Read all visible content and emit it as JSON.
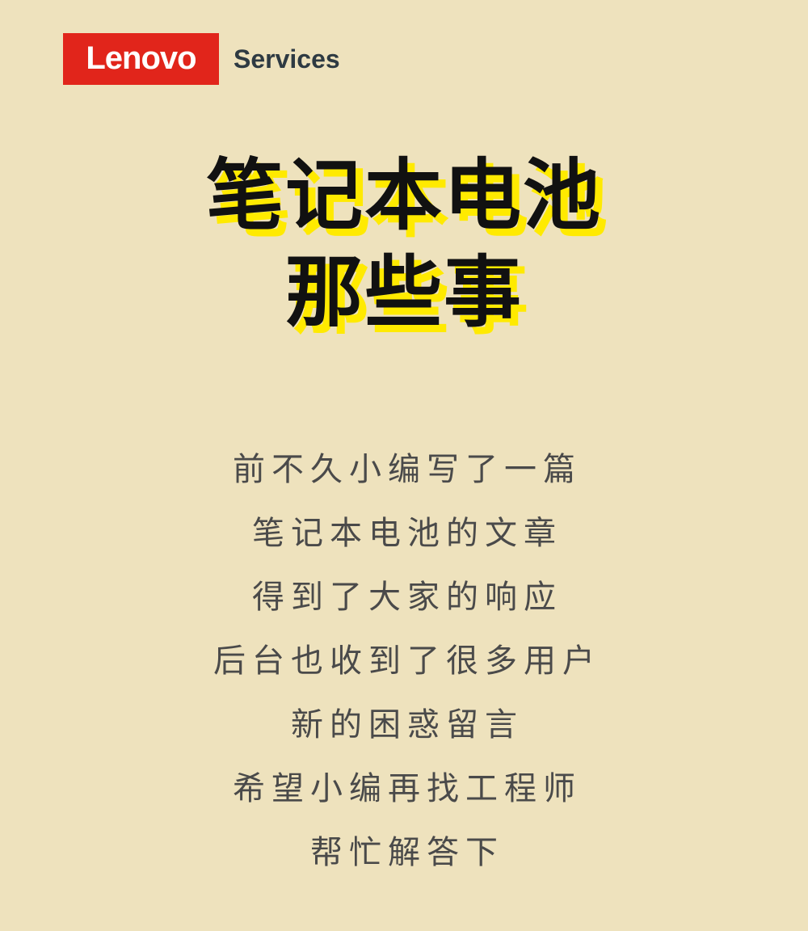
{
  "brand": {
    "logo_text": "Lenovo",
    "services_label": "Services",
    "logo_color": "#e1251b"
  },
  "headline": {
    "lines": [
      "笔记本电池",
      "那些事"
    ],
    "highlight_color": "#ffea00"
  },
  "body": {
    "lines": [
      "前不久小编写了一篇",
      "笔记本电池的文章",
      "得到了大家的响应",
      "后台也收到了很多用户",
      "新的困惑留言",
      "希望小编再找工程师",
      "帮忙解答下"
    ]
  },
  "colors": {
    "background": "#eee2bd",
    "headline_text": "#111111",
    "body_text": "#4a4a4a"
  }
}
